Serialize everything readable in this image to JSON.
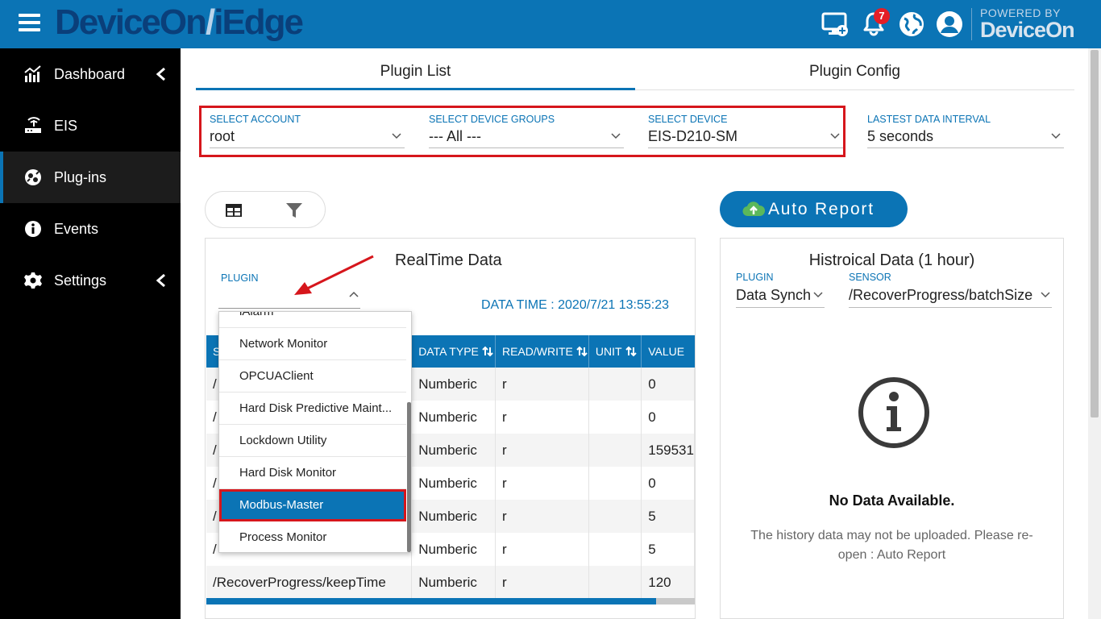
{
  "app": {
    "brand_main": "DeviceOn",
    "brand_slash": "/",
    "brand_sub": "iEdge",
    "notification_count": "7",
    "powered_small": "POWERED BY",
    "powered_big": "DeviceOn"
  },
  "sidebar": {
    "items": [
      {
        "label": "Dashboard",
        "icon": "chart-icon"
      },
      {
        "label": "EIS",
        "icon": "router-icon"
      },
      {
        "label": "Plug-ins",
        "icon": "plugin-icon"
      },
      {
        "label": "Events",
        "icon": "info-icon"
      },
      {
        "label": "Settings",
        "icon": "gear-icon"
      }
    ]
  },
  "tabs": {
    "plugin_list": "Plugin List",
    "plugin_config": "Plugin Config"
  },
  "selectors": {
    "account": {
      "label": "SELECT ACCOUNT",
      "value": "root"
    },
    "groups": {
      "label": "SELECT DEVICE GROUPS",
      "value": "--- All ---"
    },
    "device": {
      "label": "SELECT DEVICE",
      "value": "EIS-D210-SM"
    },
    "interval": {
      "label": "LASTEST DATA INTERVAL",
      "value": "5 seconds"
    }
  },
  "auto_report": {
    "label": "Auto Report"
  },
  "realtime": {
    "title": "RealTime Data",
    "plugin_label": "PLUGIN",
    "data_time": "DATA TIME : 2020/7/21 13:55:23",
    "columns": [
      "S",
      "DATA TYPE",
      "READ/WRITE",
      "UNIT",
      "VALUE"
    ],
    "rows": [
      {
        "sensor": "/",
        "type": "Numberic",
        "rw": "r",
        "unit": "",
        "value": "0"
      },
      {
        "sensor": "/",
        "type": "Numberic",
        "rw": "r",
        "unit": "",
        "value": "0"
      },
      {
        "sensor": "/",
        "type": "Numberic",
        "rw": "r",
        "unit": "",
        "value": "159531"
      },
      {
        "sensor": "/",
        "type": "Numberic",
        "rw": "r",
        "unit": "",
        "value": "0"
      },
      {
        "sensor": "/",
        "type": "Numberic",
        "rw": "r",
        "unit": "",
        "value": "5"
      },
      {
        "sensor": "/",
        "type": "Numberic",
        "rw": "r",
        "unit": "",
        "value": "5"
      },
      {
        "sensor": "/RecoverProgress/keepTime",
        "type": "Numberic",
        "rw": "r",
        "unit": "",
        "value": "120"
      }
    ]
  },
  "dropdown": {
    "items": [
      "iAlarm",
      "Network Monitor",
      "OPCUAClient",
      "Hard Disk Predictive Maint...",
      "Lockdown Utility",
      "Hard Disk Monitor",
      "Modbus-Master",
      "Process Monitor"
    ],
    "selected": "Modbus-Master"
  },
  "historical": {
    "title": "Histroical Data (1 hour)",
    "plugin_label": "PLUGIN",
    "plugin_value": "Data Synch",
    "sensor_label": "SENSOR",
    "sensor_value": "/RecoverProgress/batchSize",
    "no_data": "No Data Available.",
    "no_data_sub": "The history data may not be uploaded. Please re-open : Auto Report"
  },
  "colors": {
    "primary": "#0b74b5",
    "highlight": "#d6161c",
    "sidebar": "#000000"
  }
}
